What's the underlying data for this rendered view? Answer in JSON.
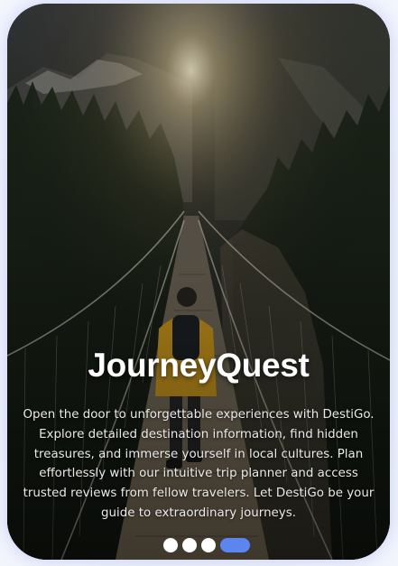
{
  "onboarding": {
    "title": "JourneyQuest",
    "description": "Open the door to unforgettable experiences with DestiGo. Explore detailed destination information, find hidden treasures, and immerse yourself in local cultures. Plan effortlessly with our intuitive trip planner and access trusted reviews from fellow travelers. Let DestiGo be your guide to extraordinary journeys.",
    "background": "hiker-on-suspension-bridge-photo"
  },
  "pagination": {
    "pages": 4,
    "active_index": 3,
    "active_color": "#5b86f0",
    "inactive_color": "#ffffff"
  },
  "colors": {
    "page_background": "#eef1fb",
    "text": "#ffffff"
  }
}
